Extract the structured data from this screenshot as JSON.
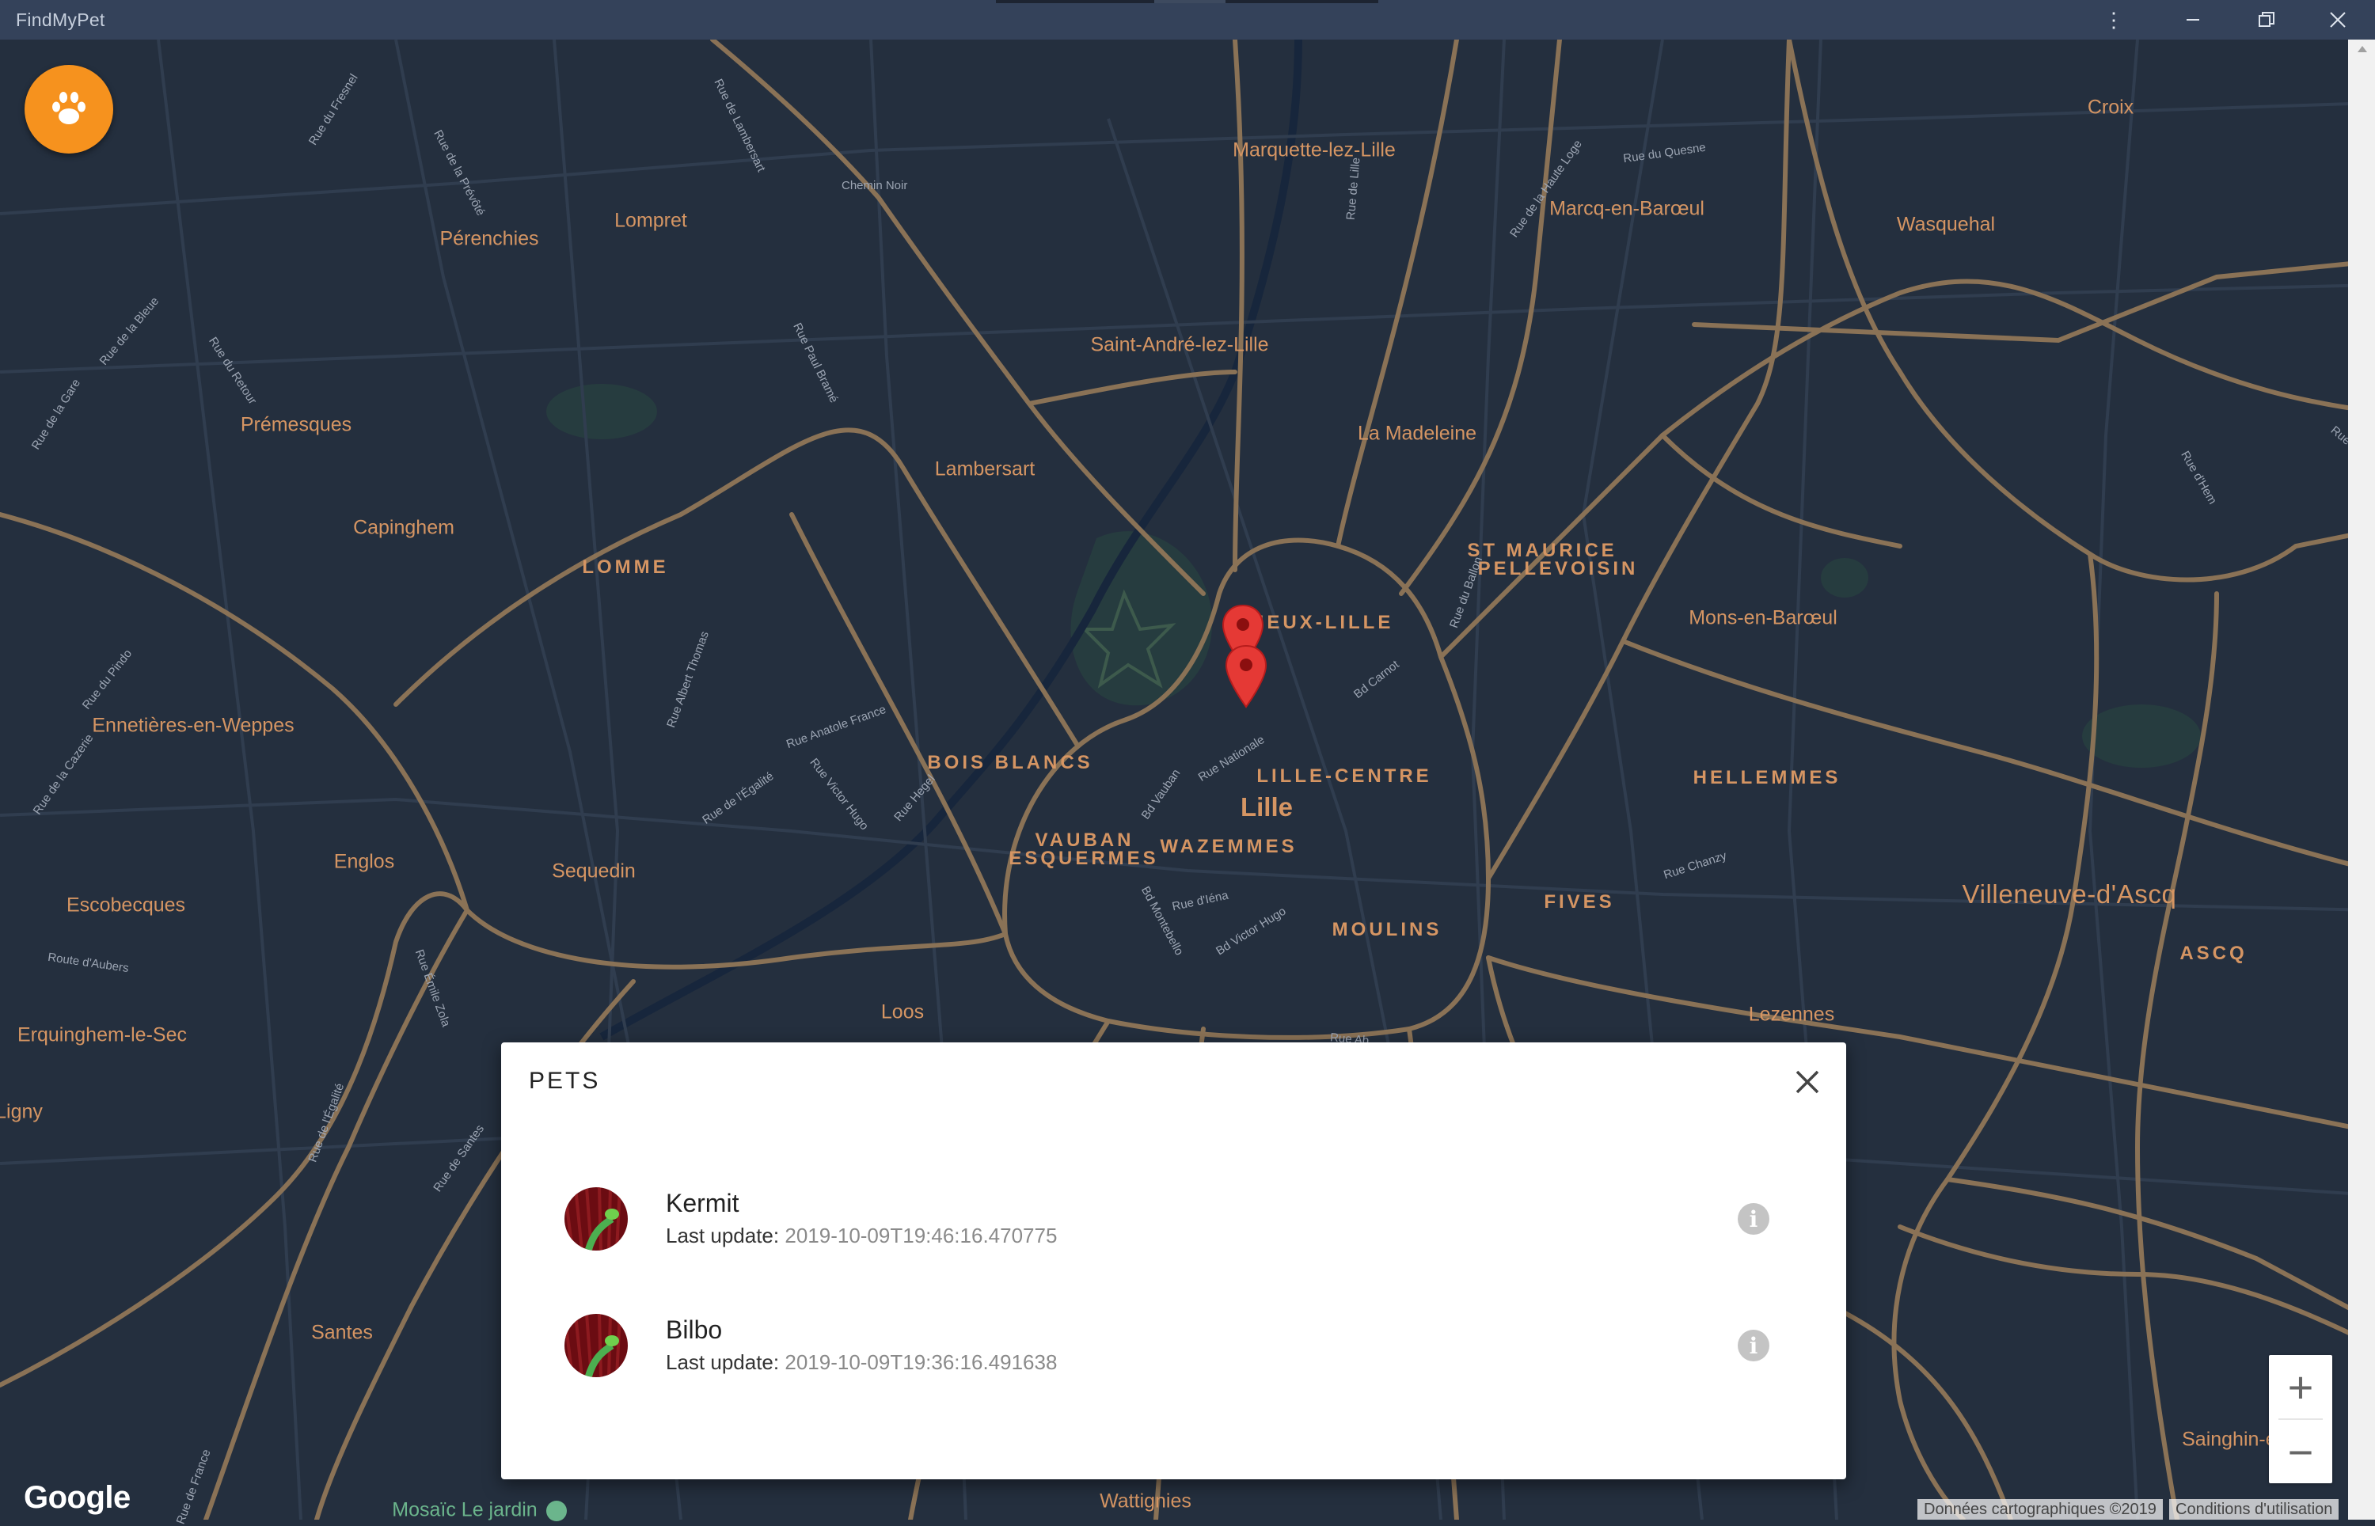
{
  "window": {
    "title": "FindMyPet"
  },
  "map": {
    "labels": [
      "Marquette-lez-Lille",
      "Croix",
      "Marcq-en-Barœul",
      "Wasquehal",
      "Pérenchies",
      "Lompret",
      "Saint-André-lez-Lille",
      "Prémesques",
      "La Madeleine",
      "Lambersart",
      "Capinghem",
      "LOMME",
      "ST MAURICE",
      "PELLEVOISIN",
      "Mons-en-Barœul",
      "VIEUX-LILLE",
      "Ennetières-en-Weppes",
      "BOIS BLANCS",
      "LILLE-CENTRE",
      "HELLEMMES",
      "Lille",
      "VAUBAN",
      "ESQUERMES",
      "WAZEMMES",
      "Englos",
      "Sequedin",
      "Villeneuve-d'Ascq",
      "Escobecques",
      "FIVES",
      "MOULINS",
      "ASCQ",
      "Loos",
      "Lezennes",
      "Erquinghem-le-Sec",
      "Ligny",
      "Santes",
      "Sainghin-en-",
      "Wattignies",
      "Mosaïc Le jardin"
    ],
    "streets": [
      "Rue du Fresnel",
      "Rue de Lambersart",
      "Chemin Noir",
      "Rue de la Prévôté",
      "Rue de la Haute Loge",
      "Rue du Quesne",
      "Rue de Lille",
      "Rue de la Bleue",
      "Rue du Retour",
      "Rue de la Gare",
      "Rue Paul Bramé",
      "Rue du Ballon",
      "Rue d'Hem",
      "Rue du Pindo",
      "Rue de la Cazerie",
      "Rue Albert Thomas",
      "Rue Anatole France",
      "Rue de l'Égalité",
      "Rue Victor Hugo",
      "Rue Hegel",
      "Bd Vauban",
      "Rue Nationale",
      "Bd Carnot",
      "Rue Chanzy",
      "Route d'Aubers",
      "Rue Émile Zola",
      "Bd Montebello",
      "Rue d'Iéna",
      "Bd Victor Hugo",
      "Rue Ab...",
      "Rue de l'Égalité",
      "Rue de Santes",
      "Rue de France",
      "Rue d..."
    ],
    "markers": [
      {
        "name": "pet-marker-kermit"
      },
      {
        "name": "pet-marker-bilbo"
      }
    ],
    "zoom_in": "+",
    "zoom_out": "−",
    "logo": "Google",
    "attribution": [
      "Données cartographiques ©2019",
      "Conditions d'utilisation"
    ]
  },
  "fab": {
    "icon": "paw-icon"
  },
  "dialog": {
    "title": "PETS",
    "close_icon": "close-icon",
    "update_label": "Last update:",
    "pets": [
      {
        "name": "Kermit",
        "last_update": "2019-10-09T19:46:16.470775",
        "avatar": "kermit-avatar",
        "info_icon": "info-icon"
      },
      {
        "name": "Bilbo",
        "last_update": "2019-10-09T19:36:16.491638",
        "avatar": "bilbo-avatar",
        "info_icon": "info-icon"
      }
    ]
  },
  "colors": {
    "map_background": "#242f3e",
    "road": "#8a7256",
    "place_label": "#d59563",
    "fab": "#f6921e",
    "marker": "#e53935",
    "titlebar": "#34425a"
  }
}
